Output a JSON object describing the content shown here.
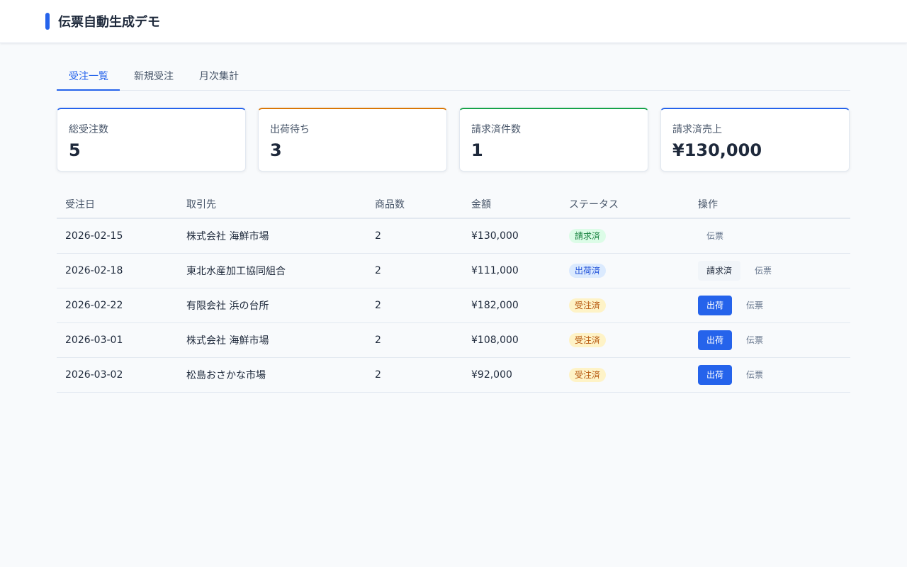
{
  "header": {
    "title": "伝票自動生成デモ"
  },
  "tabs": [
    {
      "label": "受注一覧",
      "active": true
    },
    {
      "label": "新規受注",
      "active": false
    },
    {
      "label": "月次集計",
      "active": false
    }
  ],
  "cards": [
    {
      "label": "総受注数",
      "value": "5",
      "accent": "#2563eb"
    },
    {
      "label": "出荷待ち",
      "value": "3",
      "accent": "#d97706"
    },
    {
      "label": "請求済件数",
      "value": "1",
      "accent": "#16a34a"
    },
    {
      "label": "請求済売上",
      "value": "¥130,000",
      "accent": "#2563eb"
    }
  ],
  "table": {
    "columns": [
      "受注日",
      "取引先",
      "商品数",
      "金額",
      "ステータス",
      "操作"
    ],
    "rows": [
      {
        "date": "2026-02-15",
        "client": "株式会社 海鮮市場",
        "items": "2",
        "amount": "¥130,000",
        "status": "請求済",
        "status_kind": "billed",
        "actions": [
          {
            "label": "伝票",
            "kind": "link"
          }
        ]
      },
      {
        "date": "2026-02-18",
        "client": "東北水産加工協同組合",
        "items": "2",
        "amount": "¥111,000",
        "status": "出荷済",
        "status_kind": "shipped",
        "actions": [
          {
            "label": "請求済",
            "kind": "secondary"
          },
          {
            "label": "伝票",
            "kind": "link"
          }
        ]
      },
      {
        "date": "2026-02-22",
        "client": "有限会社 浜の台所",
        "items": "2",
        "amount": "¥182,000",
        "status": "受注済",
        "status_kind": "ordered",
        "actions": [
          {
            "label": "出荷",
            "kind": "primary"
          },
          {
            "label": "伝票",
            "kind": "link"
          }
        ]
      },
      {
        "date": "2026-03-01",
        "client": "株式会社 海鮮市場",
        "items": "2",
        "amount": "¥108,000",
        "status": "受注済",
        "status_kind": "ordered",
        "actions": [
          {
            "label": "出荷",
            "kind": "primary"
          },
          {
            "label": "伝票",
            "kind": "link"
          }
        ]
      },
      {
        "date": "2026-03-02",
        "client": "松島おさかな市場",
        "items": "2",
        "amount": "¥92,000",
        "status": "受注済",
        "status_kind": "ordered",
        "actions": [
          {
            "label": "出荷",
            "kind": "primary"
          },
          {
            "label": "伝票",
            "kind": "link"
          }
        ]
      }
    ]
  },
  "status_colors": {
    "billed": {
      "bg": "#dcfce7",
      "fg": "#15803d"
    },
    "shipped": {
      "bg": "#dbeafe",
      "fg": "#1d4ed8"
    },
    "ordered": {
      "bg": "#fef3c7",
      "fg": "#b45309"
    }
  }
}
